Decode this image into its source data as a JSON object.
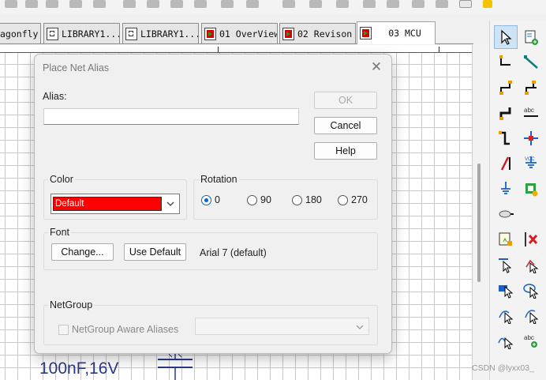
{
  "tabs": [
    {
      "label": "agonfly",
      "icon": "library-file-icon",
      "active": false
    },
    {
      "label": "LIBRARY1...",
      "icon": "library-file-icon",
      "active": false
    },
    {
      "label": "LIBRARY1...",
      "icon": "library-file-icon",
      "active": false
    },
    {
      "label": "01 OverView",
      "icon": "schematic-sheet-icon",
      "active": false
    },
    {
      "label": "02 Revison",
      "icon": "schematic-sheet-icon",
      "active": false
    },
    {
      "label": "03 MCU",
      "icon": "schematic-sheet-icon",
      "active": true
    }
  ],
  "canvas": {
    "component_value": "100nF,16V",
    "ruler_marker": "1"
  },
  "dialog": {
    "title": "Place Net Alias",
    "alias_label": "Alias:",
    "alias_value": "",
    "ok_label": "OK",
    "cancel_label": "Cancel",
    "help_label": "Help",
    "color": {
      "title": "Color",
      "selected": "Default",
      "swatch": "#ff0000"
    },
    "rotation": {
      "title": "Rotation",
      "options": [
        "0",
        "90",
        "180",
        "270"
      ],
      "selected": "0"
    },
    "font": {
      "title": "Font",
      "change_label": "Change...",
      "use_default_label": "Use Default",
      "current": "Arial 7 (default)"
    },
    "netgroup": {
      "title": "NetGroup",
      "checkbox_label": "NetGroup Aware Aliases",
      "checked": false,
      "select_value": ""
    }
  },
  "palette": {
    "tools": [
      "select-arrow-icon",
      "part-icon",
      "wire-icon",
      "net-group-wire-icon",
      "auto-connect-two-points-icon",
      "auto-connect-multi-icon",
      "bus-icon",
      "net-alias-icon",
      "bus-entry-icon",
      "bus-junction-icon",
      "power-icon",
      "ground-icon",
      "no-connect-icon",
      "junction-icon",
      "off-page-connector-icon",
      "hierarchical-block-icon",
      "hierarchical-port-icon",
      "hierarchical-pin-icon",
      "line-icon",
      "polyline-icon",
      "rectangle-icon",
      "ellipse-icon",
      "arc-icon",
      "elliptical-arc-icon",
      "bezier-icon",
      "text-icon"
    ]
  },
  "watermark": "CSDN @lyxx03_"
}
